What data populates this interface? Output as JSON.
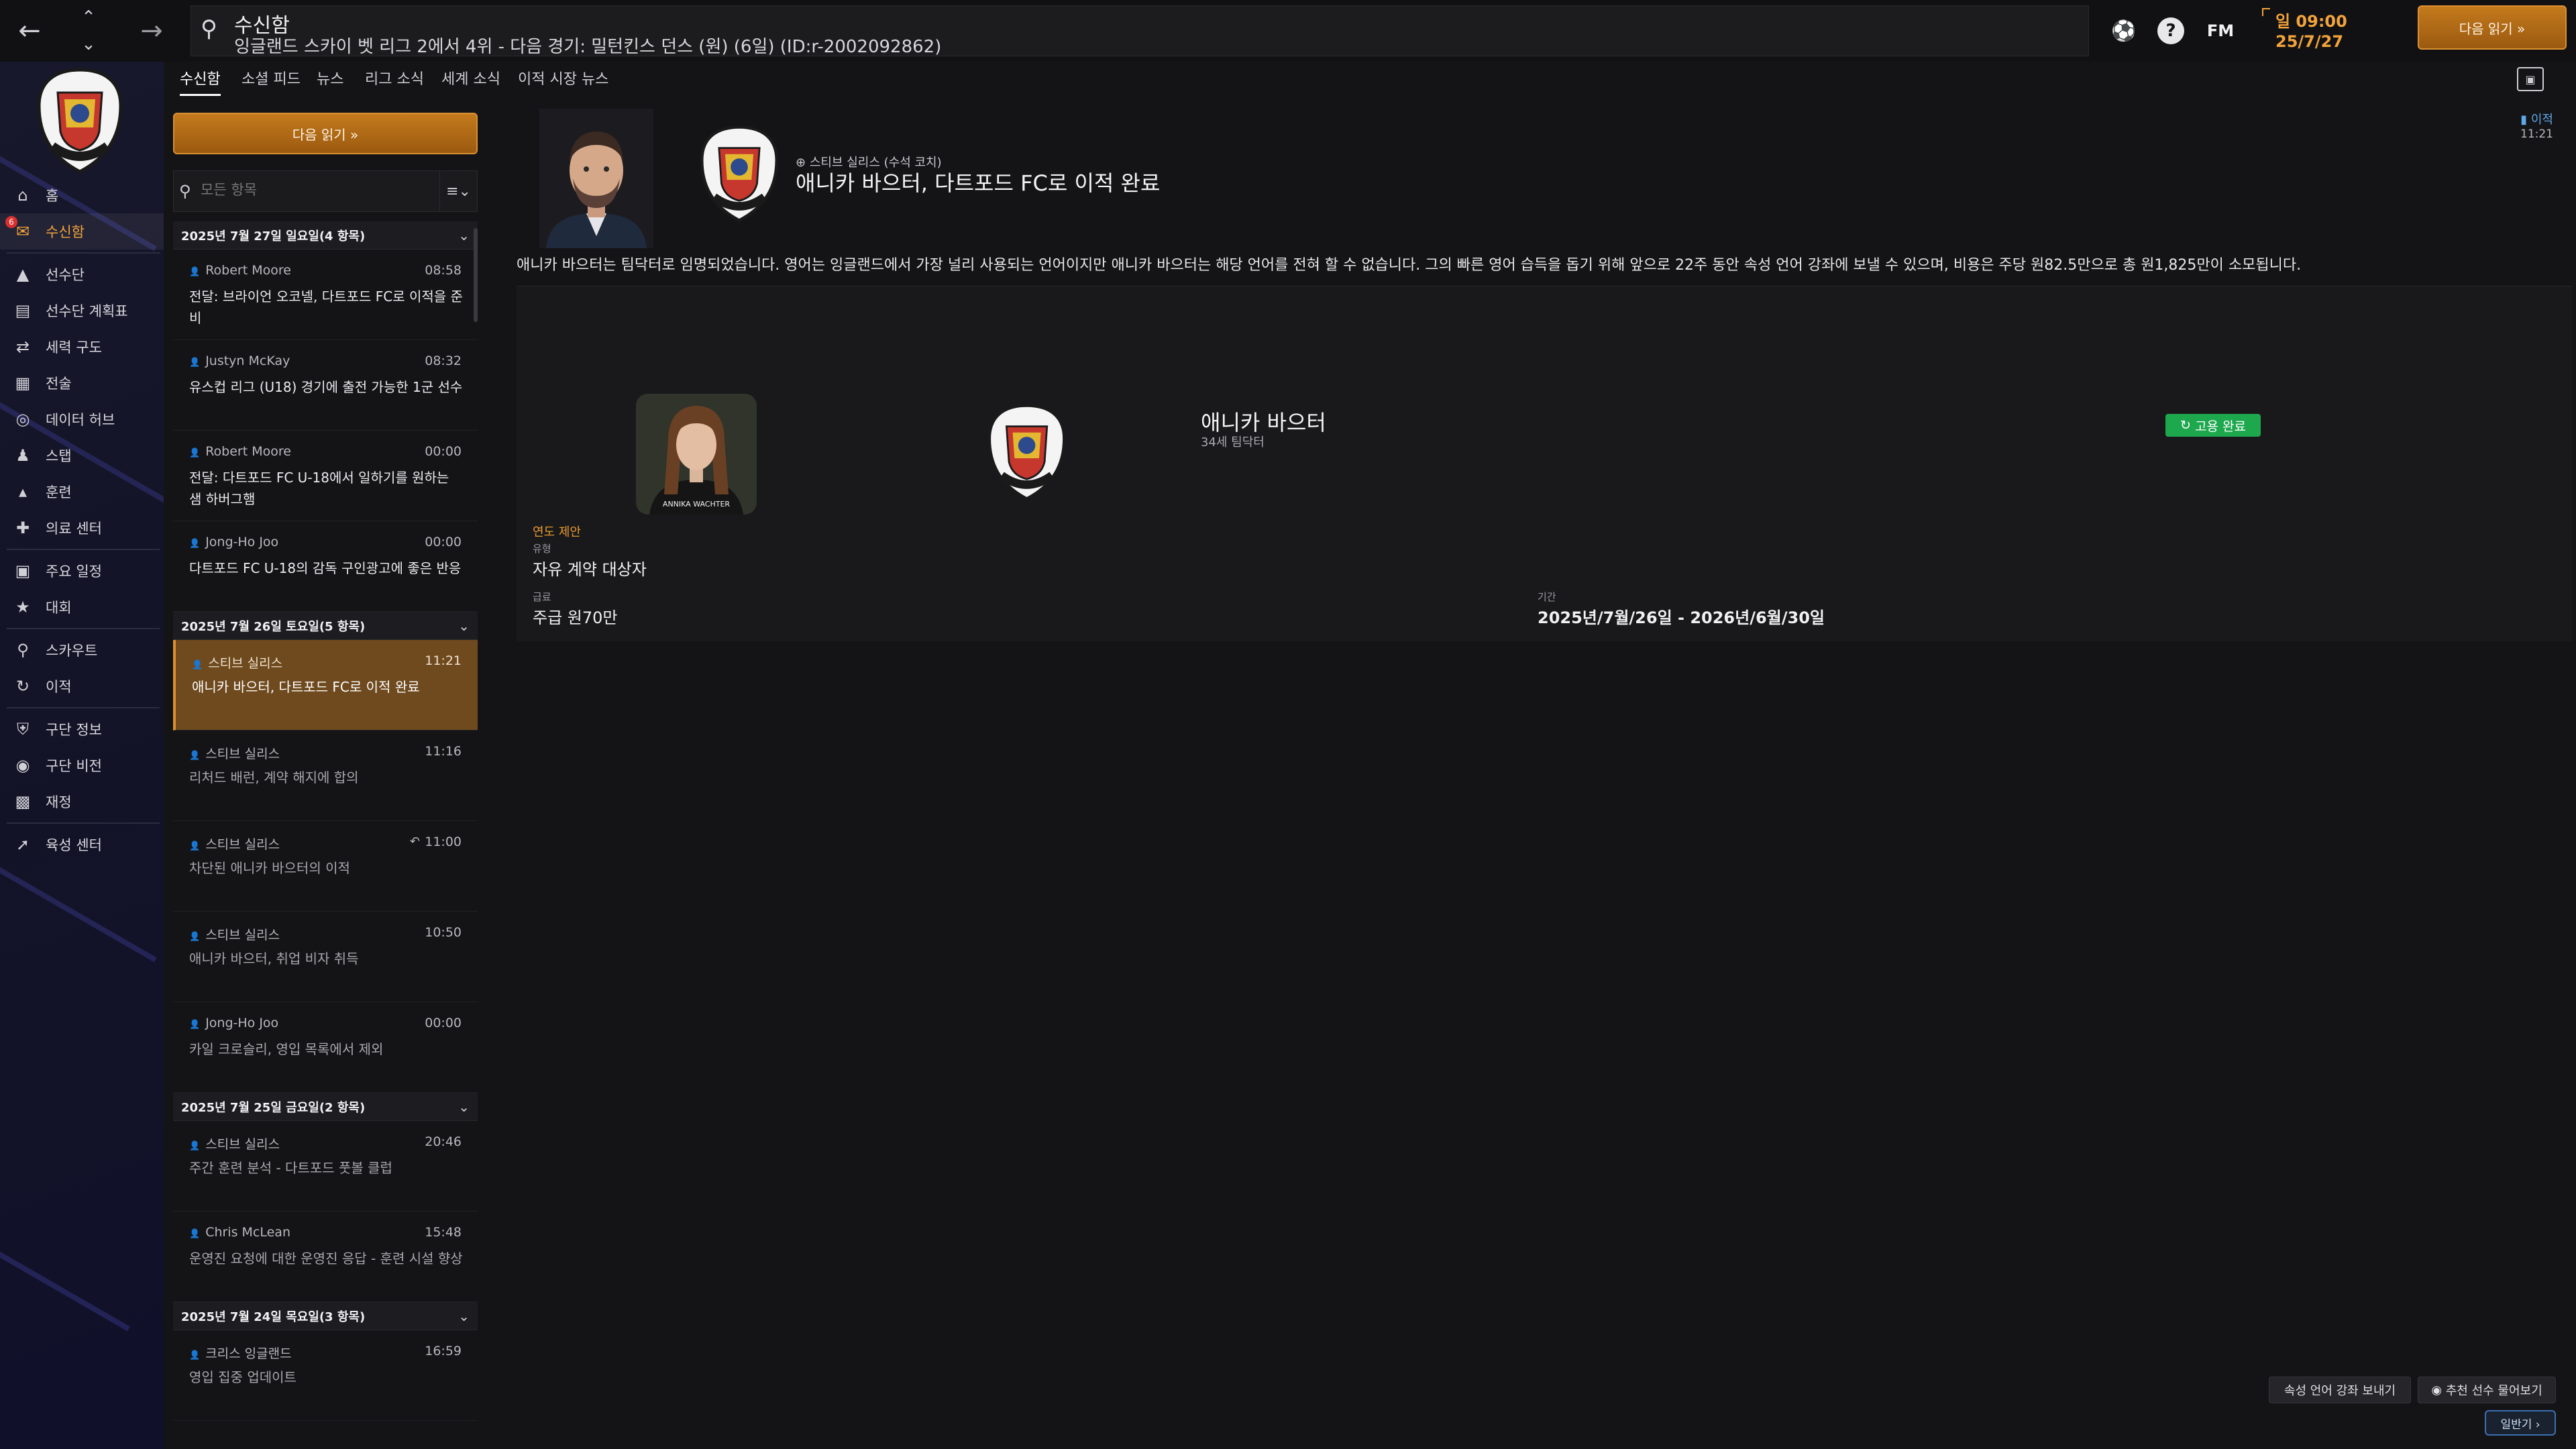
{
  "topbar": {
    "title": "수신함",
    "subtitle": "잉글랜드 스카이 벳 리그 2에서 4위 - 다음 경기: 밀턴킨스 던스 (원) (6일) (ID:r-2002092862)",
    "clock_time": "일 09:00",
    "clock_date": "25/7/27",
    "continue_label": "다음 읽기 »",
    "fm_label": "FM",
    "help_label": "?"
  },
  "sidebar": {
    "items": [
      {
        "label": "홈",
        "icon": "home-icon",
        "glyph": "⌂"
      },
      {
        "label": "수신함",
        "icon": "inbox-icon",
        "glyph": "✉",
        "active": true,
        "badge": "6"
      },
      {
        "label": "선수단",
        "icon": "shirt-icon",
        "glyph": "👕"
      },
      {
        "label": "선수단 계획표",
        "icon": "clipboard-icon",
        "glyph": "▤"
      },
      {
        "label": "세력 구도",
        "icon": "dynamics-icon",
        "glyph": "⇄"
      },
      {
        "label": "전술",
        "icon": "tactics-icon",
        "glyph": "▦"
      },
      {
        "label": "데이터 허브",
        "icon": "data-hub-icon",
        "glyph": "◎"
      },
      {
        "label": "스탭",
        "icon": "staff-icon",
        "glyph": "👥"
      },
      {
        "label": "훈련",
        "icon": "training-icon",
        "glyph": "▲"
      },
      {
        "label": "의료 센터",
        "icon": "medical-icon",
        "glyph": "✚"
      },
      {
        "label": "주요 일정",
        "icon": "calendar-icon",
        "glyph": "▦"
      },
      {
        "label": "대회",
        "icon": "trophy-icon",
        "glyph": "🏆"
      },
      {
        "label": "스카우트",
        "icon": "scout-icon",
        "glyph": "🔍"
      },
      {
        "label": "이적",
        "icon": "transfer-icon",
        "glyph": "↻"
      },
      {
        "label": "구단 정보",
        "icon": "shield-icon",
        "glyph": "⛨"
      },
      {
        "label": "구단 비전",
        "icon": "vision-icon",
        "glyph": "◉"
      },
      {
        "label": "재정",
        "icon": "finance-icon",
        "glyph": "¤"
      },
      {
        "label": "육성 센터",
        "icon": "development-icon",
        "glyph": "⟋"
      }
    ]
  },
  "tabs": [
    "수신함",
    "소셜 피드",
    "뉴스",
    "리그 소식",
    "세계 소식",
    "이적 시장 뉴스"
  ],
  "inbox": {
    "continue_label": "다음 읽기 »",
    "filter_placeholder": "모든 항목",
    "groups": [
      {
        "date": "2025년 7월 27일 일요일(4 항목)",
        "messages": [
          {
            "sender": "Robert Moore",
            "time": "08:58",
            "subject": "전달: 브라이언 오코넬, 다트포드 FC로 이적을 준비",
            "read": false
          },
          {
            "sender": "Justyn McKay",
            "time": "08:32",
            "subject": "유스컵 리그 (U18) 경기에 출전 가능한 1군 선수",
            "read": false
          },
          {
            "sender": "Robert Moore",
            "time": "00:00",
            "subject": "전달: 다트포드 FC U-18에서 일하기를 원하는 샘 하버그햄",
            "read": false
          },
          {
            "sender": "Jong-Ho Joo",
            "time": "00:00",
            "subject": "다트포드 FC U-18의 감독 구인광고에 좋은 반응",
            "read": false
          }
        ]
      },
      {
        "date": "2025년 7월 26일 토요일(5 항목)",
        "messages": [
          {
            "sender": "스티브 실리스",
            "time": "11:21",
            "subject": "애니카 바으터, 다트포드 FC로 이적 완료",
            "read": true,
            "selected": true
          },
          {
            "sender": "스티브 실리스",
            "time": "11:16",
            "subject": "리처드 배런, 계약 해지에 합의",
            "read": true
          },
          {
            "sender": "스티브 실리스",
            "time": "11:00",
            "subject": "차단된 애니카 바으터의 이적",
            "read": true,
            "replied": true
          },
          {
            "sender": "스티브 실리스",
            "time": "10:50",
            "subject": "애니카 바으터, 취업 비자 취득",
            "read": true
          },
          {
            "sender": "Jong-Ho Joo",
            "time": "00:00",
            "subject": "카일 크로슬리, 영입 목록에서 제외",
            "read": true
          }
        ]
      },
      {
        "date": "2025년 7월 25일 금요일(2 항목)",
        "messages": [
          {
            "sender": "스티브 실리스",
            "time": "20:46",
            "subject": "주간 훈련 분석 - 다트포드 풋볼 클럽",
            "read": true
          },
          {
            "sender": "Chris McLean",
            "time": "15:48",
            "subject": "운영진 요청에 대한 운영진 응답 - 훈련 시설 향상",
            "read": true
          }
        ]
      },
      {
        "date": "2025년 7월 24일 목요일(3 항목)",
        "messages": [
          {
            "sender": "크리스 잉글랜드",
            "time": "16:59",
            "subject": "영입 집중 업데이트",
            "read": true
          }
        ]
      }
    ]
  },
  "detail": {
    "from": "스티브 실리스 (수석 코치)",
    "subject": "애니카 바으터, 다트포드 FC로 이적 완료",
    "tag": "이적",
    "time": "11:21",
    "body": "애니카 바으터는 팀닥터로 임명되었습니다. 영어는 잉글랜드에서 가장 널리 사용되는 언어이지만 애니카 바으터는 해당 언어를 전혀 할 수 없습니다. 그의 빠른 영어 습득을 돕기 위해 앞으로 22주 동안 속성 언어 강좌에 보낼 수 있으며, 비용은 주당 원82.5만으로 총 원1,825만이 소모됩니다.",
    "player_name": "애니카 바으터",
    "player_meta": "34세 팀닥터",
    "player_photo_caption": "ANNIKA WACHTER",
    "hired_label": "고용 완료",
    "offer_label": "연도 제안",
    "club_crest_text": "DARTFORD F.C.",
    "fields": {
      "type_label": "유형",
      "type_value": "자유 계약 대상자",
      "wage_label": "급료",
      "wage_value": "주급 원70만",
      "period_label": "기간",
      "period_value": "2025년/7월/26일 - 2026년/6월/30일"
    }
  },
  "bottom": {
    "language_course_label": "속성 언어 강좌 보내기",
    "recommend_label": "추천 선수 물어보기",
    "more_label": "일반기 ›"
  },
  "colors": {
    "accent": "#f2a33a",
    "continue_button": "#b06a16",
    "hired_badge": "#1ea84e",
    "selected_row": "#6e4a1e",
    "transfer_tag": "#5fa8e8"
  }
}
